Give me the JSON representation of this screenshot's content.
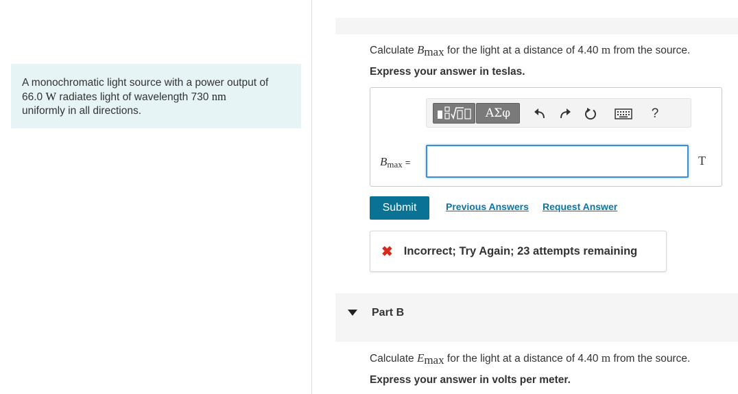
{
  "problem": {
    "text_before_power": "A monochromatic light source with a power output of",
    "power_value": "66.0",
    "power_unit": "W",
    "text_after_power": "radiates light of wavelength 730",
    "wavelength_unit": "nm",
    "text_end": "uniformly in all directions."
  },
  "partA": {
    "q_before": "Calculate",
    "q_var": "B",
    "q_sub": "max",
    "q_after": "for the light at a distance of 4.40",
    "q_unit": "m",
    "q_end": "from the source.",
    "instruction": "Express your answer in teslas.",
    "toolbar": {
      "greek_label": "ΑΣφ",
      "help_label": "?"
    },
    "input_label_var": "B",
    "input_label_sub": "max",
    "input_label_eq": "=",
    "input_value": "",
    "unit": "T",
    "submit_label": "Submit",
    "previous_answers_label": "Previous Answers",
    "request_answer_label": "Request Answer",
    "feedback_text": "Incorrect; Try Again; 23 attempts remaining",
    "feedback_color": "#d52b1e"
  },
  "partB": {
    "title": "Part B",
    "q_before": "Calculate",
    "q_var": "E",
    "q_sub": "max",
    "q_after": "for the light at a distance of 4.40",
    "q_unit": "m",
    "q_end": "from the source.",
    "instruction": "Express your answer in volts per meter."
  },
  "colors": {
    "submit_bg": "#0a7395",
    "link": "#0a73a8",
    "problem_bg": "#e7f4f6",
    "input_border": "#3a8fd6"
  }
}
